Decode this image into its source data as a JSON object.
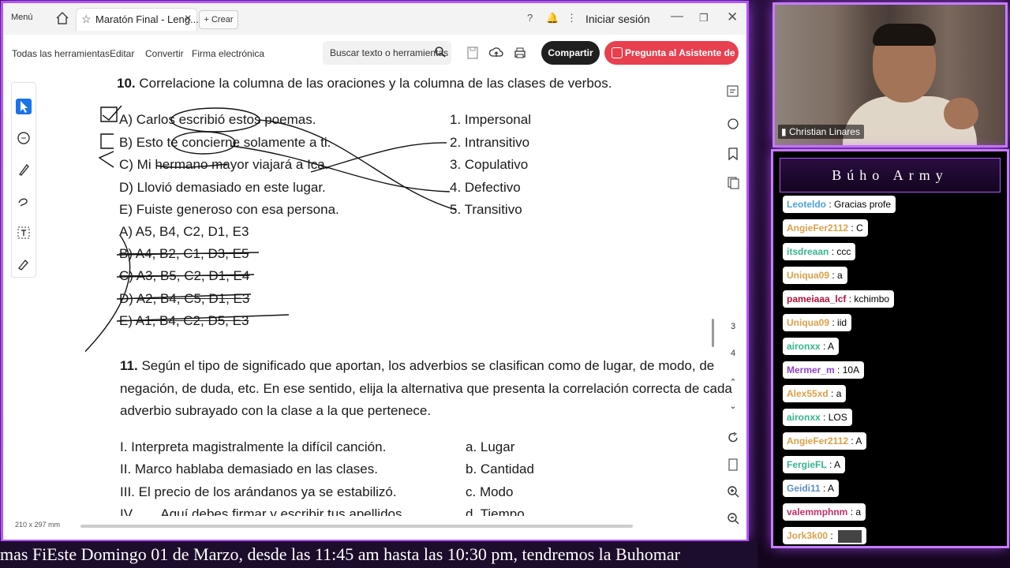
{
  "app": {
    "menu_label": "Menú",
    "tab_title": "Maratón Final - Leng...",
    "new_tab_label": "Crear",
    "sign_in": "Iniciar sesión"
  },
  "toolbar": {
    "items": [
      "Todas las herramientas",
      "Editar",
      "Convertir",
      "Firma electrónica"
    ],
    "search_placeholder": "Buscar texto o herramientas",
    "share_label": "Compartir",
    "ai_label": "Pregunta al Asistente de IA"
  },
  "document": {
    "q10": {
      "number": "10.",
      "prompt": "Correlacione la columna de las oraciones y la columna de las clases de verbos.",
      "left": [
        "A) Carlos escribió estos poemas.",
        "B) Esto te concierne solamente a ti.",
        "C) Mi hermano mayor viajará a Ica.",
        "D) Llovió demasiado en este lugar.",
        "E) Fuiste generoso con esa persona."
      ],
      "right": [
        "1. Impersonal",
        "2. Intransitivo",
        "3. Copulativo",
        "4. Defectivo",
        "5. Transitivo"
      ],
      "options": [
        "A) A5, B4, C2, D1, E3",
        "B) A4, B2, C1, D3, E5",
        "C) A3, B5, C2, D1, E4",
        "D) A2, B4, C5, D1, E3",
        "E) A1, B4, C2, D5, E3"
      ]
    },
    "q11": {
      "number": "11.",
      "line1": "Según el tipo de significado que aportan, los adverbios se clasifican como de lugar, de modo, de",
      "line2": "negación, de duda, etc. En ese sentido, elija la alternativa que presenta la correlación correcta de cada",
      "line3": "adverbio subrayado con la clase a la que pertenece.",
      "items": [
        "I. Interpreta magistralmente la difícil canción.",
        "II. Marco hablaba demasiado en las clases.",
        "III. El precio de los arándanos ya se estabilizó.",
        "IV.       Aquí debes firmar y escribir tus apellidos."
      ],
      "classes": [
        "a. Lugar",
        "b. Cantidad",
        "c. Modo",
        "d. Tiempo"
      ]
    },
    "page_size": "210 x 297 mm",
    "page_numbers": [
      "3",
      "4"
    ]
  },
  "webcam": {
    "name": "Christian Linares"
  },
  "chat": {
    "title": "Búho Army",
    "messages": [
      {
        "user": "Leoteldo",
        "text": "Gracias profe",
        "color": "#4aa3d8"
      },
      {
        "user": "AngieFer2112",
        "text": "C",
        "color": "#d9a14a"
      },
      {
        "user": "itsdreaan",
        "text": "ccc",
        "color": "#36b58f"
      },
      {
        "user": "Uniqua09",
        "text": "a",
        "color": "#d9a14a"
      },
      {
        "user": "pameiaaa_lcf",
        "text": "kchimbo",
        "color": "#b3123a"
      },
      {
        "user": "Uniqua09",
        "text": "iid",
        "color": "#d9a14a"
      },
      {
        "user": "aironxx",
        "text": "A",
        "color": "#36b58f"
      },
      {
        "user": "Mermer_m",
        "text": "10A",
        "color": "#8e44c9"
      },
      {
        "user": "Alex55xd",
        "text": "a",
        "color": "#d9a14a"
      },
      {
        "user": "aironxx",
        "text": "LOS",
        "color": "#36b58f"
      },
      {
        "user": "AngieFer2112",
        "text": "A",
        "color": "#d9a14a"
      },
      {
        "user": "FergieFL",
        "text": "A",
        "color": "#36b58f"
      },
      {
        "user": "Geidi11",
        "text": "A",
        "color": "#5f8fbf"
      },
      {
        "user": "valemmphnm",
        "text": "a",
        "color": "#c0306a"
      },
      {
        "user": "Jork3k00",
        "text": "",
        "color": "#d9a14a"
      }
    ]
  },
  "ticker": {
    "text": "mas FiEste Domingo 01 de Marzo, desde las 11:45 am hasta las 10:30 pm, tendremos la Buhomar"
  }
}
